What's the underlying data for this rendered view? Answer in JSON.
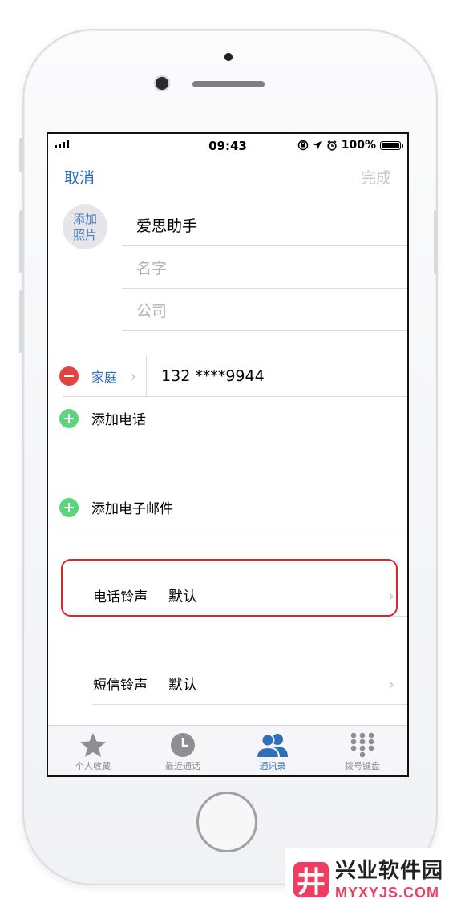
{
  "status_bar": {
    "time": "09:43",
    "battery": "100%",
    "battery_level": 1.0
  },
  "nav": {
    "cancel": "取消",
    "done": "完成"
  },
  "contact": {
    "add_photo_line1": "添加",
    "add_photo_line2": "照片",
    "last_name": "爱思助手",
    "first_name_placeholder": "名字",
    "company_placeholder": "公司"
  },
  "phone": {
    "label": "家庭",
    "number": "132 ****9944",
    "add_phone": "添加电话"
  },
  "email": {
    "add_email": "添加电子邮件"
  },
  "ringtone": {
    "label": "电话铃声",
    "value": "默认"
  },
  "text_tone": {
    "label": "短信铃声",
    "value": "默认"
  },
  "tabbar": {
    "tabs": [
      {
        "label": "个人收藏",
        "icon": "star-icon",
        "active": false
      },
      {
        "label": "最近通话",
        "icon": "clock-icon",
        "active": false
      },
      {
        "label": "通讯录",
        "icon": "contacts-icon",
        "active": true
      },
      {
        "label": "拨号键盘",
        "icon": "keypad-icon",
        "active": false
      }
    ]
  },
  "colors": {
    "accent": "#2f6fba",
    "highlight": "#d9262c",
    "delete": "#e0443e",
    "add": "#5fd37b"
  },
  "watermark": {
    "logo_glyph": "井",
    "title": "兴业软件园",
    "subtitle": "MYXYJS.COM"
  }
}
